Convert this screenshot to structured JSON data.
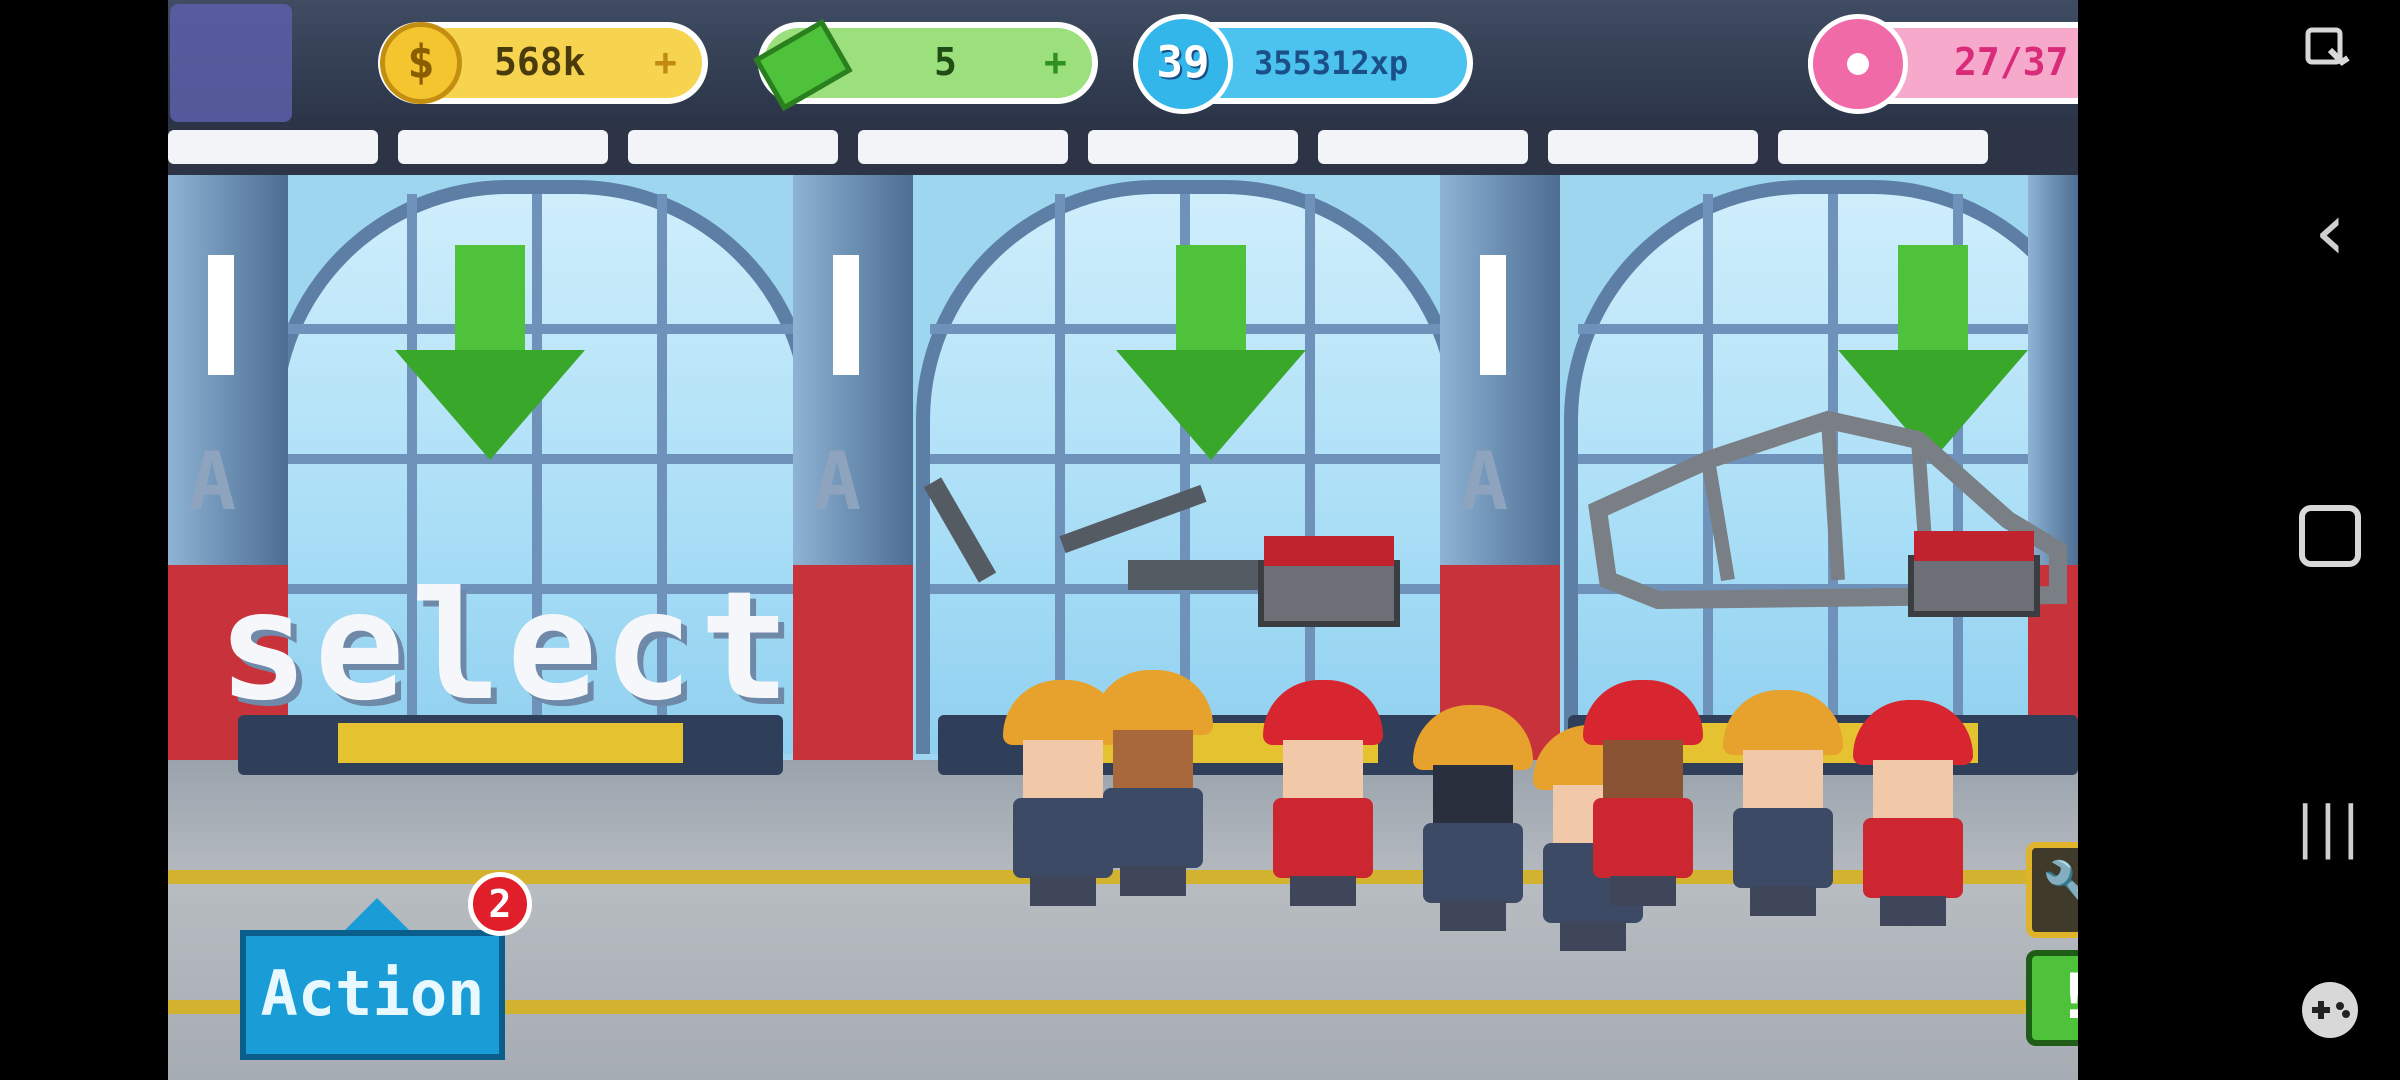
{
  "hud": {
    "coins": "568k",
    "cash": "5",
    "level": "39",
    "xp": "355312xp",
    "energy": "27/37",
    "plus_glyph": "+"
  },
  "scene": {
    "select_text": "select"
  },
  "action": {
    "label": "Action",
    "badge": "2"
  },
  "side_buttons": {
    "wrench_glyph": "🔧",
    "alert_glyph": "!"
  },
  "system_nav": {
    "back": "‹",
    "home": "▢",
    "recents": "|||"
  },
  "colors": {
    "coin": "#f5c530",
    "cash": "#4ec23a",
    "xp": "#33b7ea",
    "energy": "#f06aa8",
    "action": "#1a9dd6",
    "alert": "#4ec23a",
    "wrench": "#e0b42a"
  },
  "icons": [
    "coin-icon",
    "cash-icon",
    "xp-level-icon",
    "donut-icon",
    "wrench-icon",
    "alert-icon",
    "screenshot-tool-icon",
    "gamepad-icon"
  ]
}
